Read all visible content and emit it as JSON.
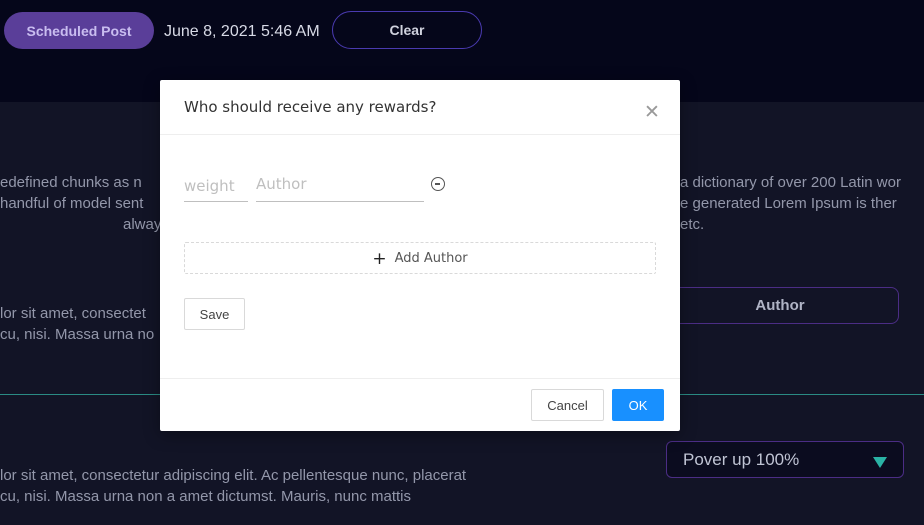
{
  "header": {
    "scheduled_label": "Scheduled Post",
    "date": "June 8, 2021 5:46 AM",
    "clear_label": "Clear"
  },
  "background": {
    "lines": [
      "edefined chunks as n",
      "a dictionary of over 200 Latin wor",
      "handful of model sent",
      "e generated Lorem Ipsum is ther",
      "alway",
      "etc.",
      "lor sit amet, consectet",
      "cu, nisi. Massa urna no",
      "lor sit amet, consectetur adipiscing elit. Ac pellentesque nunc, placerat",
      "cu, nisi. Massa urna non a amet dictumst. Mauris, nunc mattis"
    ],
    "author_button": "Author",
    "power_select": "Pover up 100%"
  },
  "modal": {
    "title": "Who should receive any rewards?",
    "weight_placeholder": "weight",
    "author_placeholder": "Author",
    "add_author": "Add Author",
    "save": "Save",
    "cancel": "Cancel",
    "ok": "OK"
  },
  "colors": {
    "scheduled_bg": "#5a3e99",
    "ok_bg": "#1890ff",
    "teal": "#2ab3a5"
  }
}
